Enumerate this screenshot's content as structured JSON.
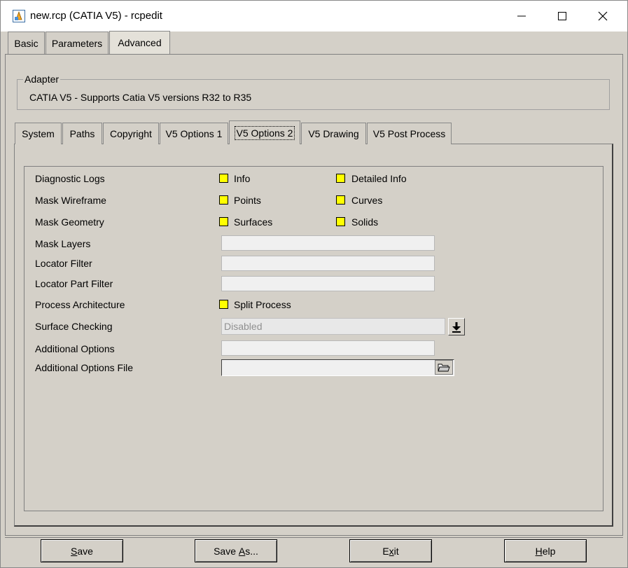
{
  "window": {
    "title": "new.rcp (CATIA V5) - rcpedit",
    "app_icon": "rcpedit-app-icon",
    "controls": [
      "minimize-icon",
      "maximize-icon",
      "close-icon"
    ]
  },
  "main_tabs": [
    {
      "label": "Basic",
      "active": false
    },
    {
      "label": "Parameters",
      "active": false
    },
    {
      "label": "Advanced",
      "active": true
    }
  ],
  "adapter": {
    "legend": "Adapter",
    "text": "CATIA V5  -  Supports Catia V5 versions R32 to R35"
  },
  "sub_tabs": [
    {
      "label": "System",
      "active": false
    },
    {
      "label": "Paths",
      "active": false
    },
    {
      "label": "Copyright",
      "active": false
    },
    {
      "label": "V5 Options 1",
      "active": false
    },
    {
      "label": "V5 Options 2",
      "active": true
    },
    {
      "label": "V5 Drawing",
      "active": false
    },
    {
      "label": "V5 Post Process",
      "active": false
    }
  ],
  "options": {
    "diagnostic_logs": {
      "label": "Diagnostic Logs",
      "cb1": "Info",
      "cb2": "Detailed Info"
    },
    "mask_wireframe": {
      "label": "Mask Wireframe",
      "cb1": "Points",
      "cb2": "Curves"
    },
    "mask_geometry": {
      "label": "Mask Geometry",
      "cb1": "Surfaces",
      "cb2": "Solids"
    },
    "mask_layers": {
      "label": "Mask Layers",
      "value": ""
    },
    "locator_filter": {
      "label": "Locator Filter",
      "value": ""
    },
    "locator_part_filter": {
      "label": "Locator Part Filter",
      "value": ""
    },
    "process_architecture": {
      "label": "Process Architecture",
      "cb1": "Split Process"
    },
    "surface_checking": {
      "label": "Surface Checking",
      "value": "Disabled"
    },
    "additional_options": {
      "label": "Additional Options",
      "value": ""
    },
    "additional_options_file": {
      "label": "Additional Options File",
      "value": ""
    }
  },
  "colors": {
    "checkbox_fill": "#ffff00",
    "background": "#d4d0c8"
  },
  "buttons": {
    "save": {
      "pre": "",
      "u": "S",
      "post": "ave"
    },
    "save_as": {
      "pre": "Save ",
      "u": "A",
      "post": "s..."
    },
    "exit": {
      "pre": "E",
      "u": "x",
      "post": "it"
    },
    "help": {
      "pre": "",
      "u": "H",
      "post": "elp"
    }
  }
}
